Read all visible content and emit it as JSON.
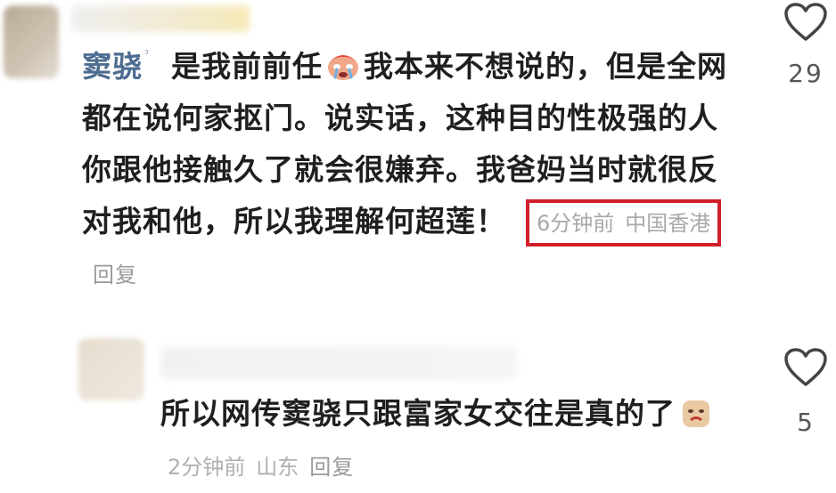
{
  "comments": [
    {
      "username": "窦骁",
      "user_tag_icon": "search-tag-icon",
      "text_before_emoji": "是我前前任",
      "emoji_icon": "crying-face-emoji",
      "text_after_emoji": "我本来不想说的，但是全网都在说何家抠门。说实话，这种目的性极强的人你跟他接触久了就会很嫌弃。我爸妈当时就很反对我和他，所以我理解何超莲！",
      "time": "6分钟前",
      "location": "中国香港",
      "reply_label": "回复",
      "likes": "29",
      "highlight_color": "#d01f2b"
    },
    {
      "text": "所以网传窦骁只跟富家女交往是真的了",
      "emoji_icon": "face-emoji",
      "time": "2分钟前",
      "location": "山东",
      "reply_label": "回复",
      "likes": "5"
    }
  ],
  "colors": {
    "username": "#4d6c91",
    "text": "#1f1f1f",
    "meta": "#b0b0b0"
  }
}
